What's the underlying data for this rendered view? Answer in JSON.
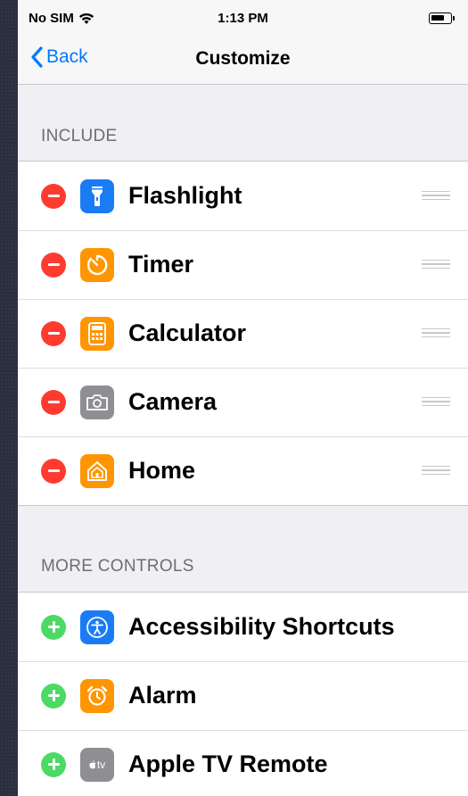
{
  "status_bar": {
    "carrier": "No SIM",
    "time": "1:13 PM"
  },
  "nav": {
    "back_label": "Back",
    "title": "Customize"
  },
  "include": {
    "header": "INCLUDE",
    "items": [
      {
        "label": "Flashlight",
        "icon": "flashlight-icon",
        "color": "#1a7cf5"
      },
      {
        "label": "Timer",
        "icon": "timer-icon",
        "color": "#ff9500"
      },
      {
        "label": "Calculator",
        "icon": "calculator-icon",
        "color": "#ff9500"
      },
      {
        "label": "Camera",
        "icon": "camera-icon",
        "color": "#8e8e93"
      },
      {
        "label": "Home",
        "icon": "home-icon",
        "color": "#ff9500"
      }
    ]
  },
  "more_controls": {
    "header": "MORE CONTROLS",
    "items": [
      {
        "label": "Accessibility Shortcuts",
        "icon": "accessibility-icon",
        "color": "#1a7cf5"
      },
      {
        "label": "Alarm",
        "icon": "alarm-icon",
        "color": "#ff9500"
      },
      {
        "label": "Apple TV Remote",
        "icon": "apple-tv-icon",
        "color": "#8e8e93",
        "icon_text": "tv"
      }
    ]
  },
  "colors": {
    "remove": "#ff3b30",
    "add": "#4cd964",
    "tint": "#007aff"
  }
}
